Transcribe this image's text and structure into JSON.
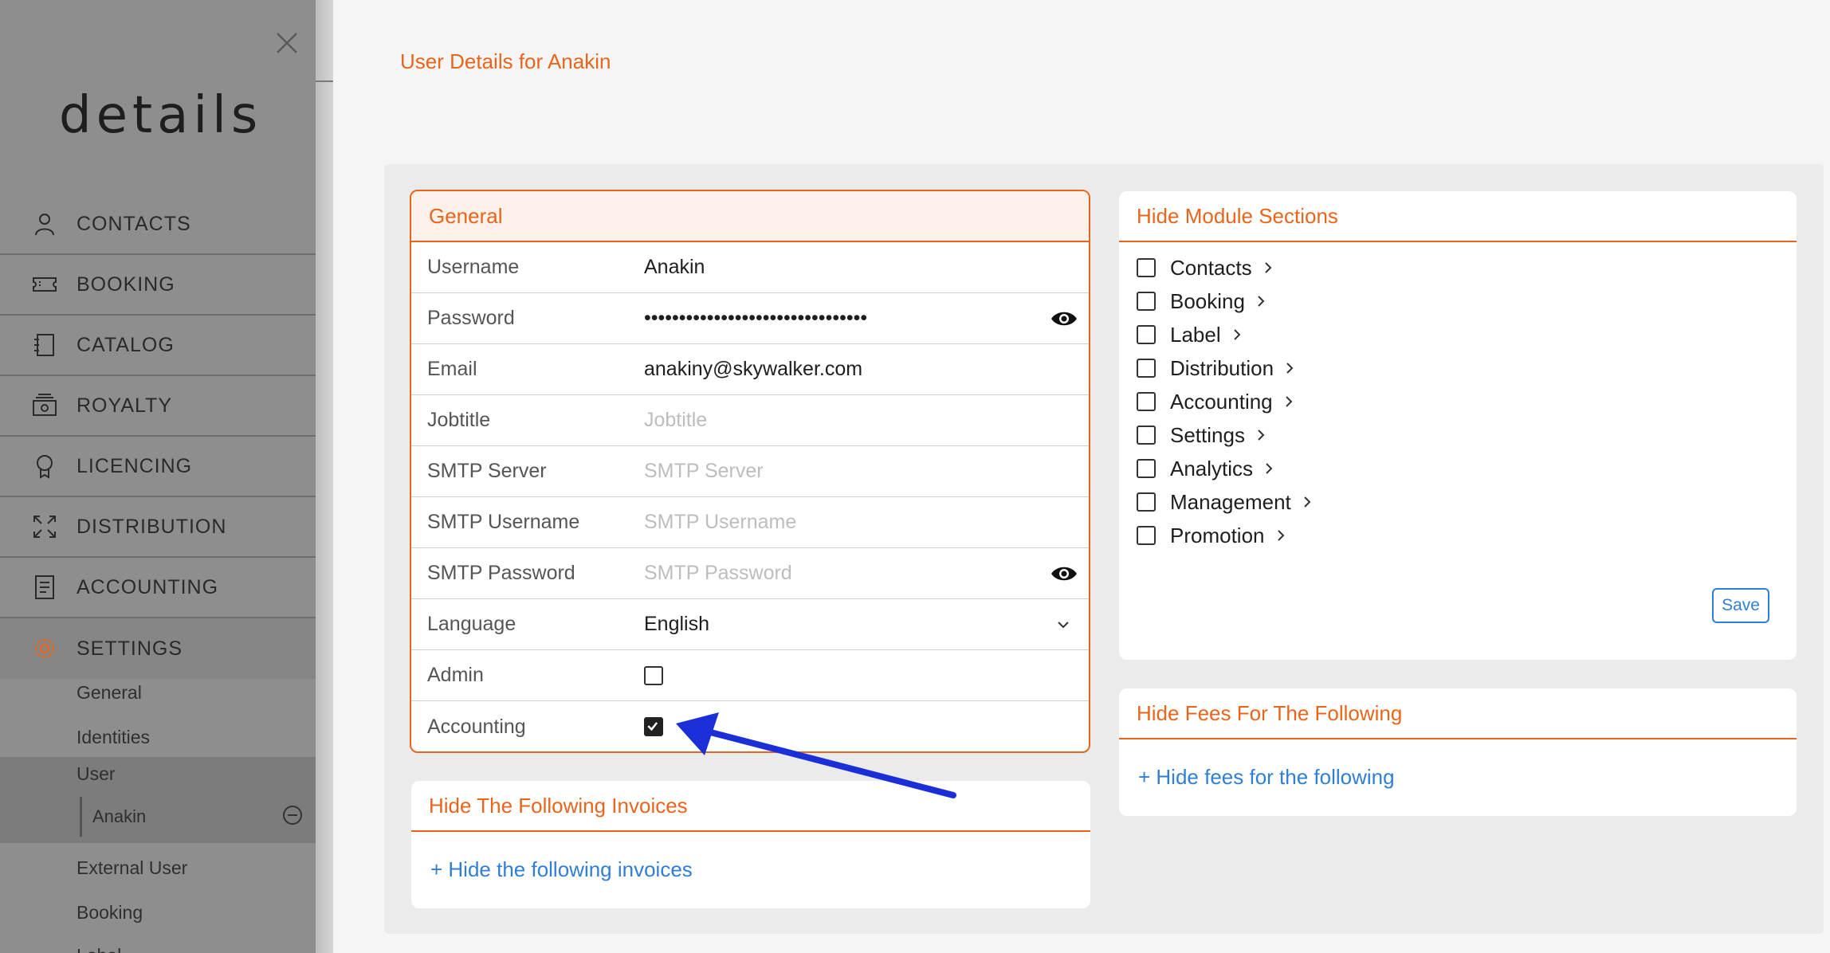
{
  "sidebar": {
    "logo": "details",
    "nav": [
      {
        "label": "CONTACTS",
        "icon": "person-icon"
      },
      {
        "label": "BOOKING",
        "icon": "ticket-icon"
      },
      {
        "label": "CATALOG",
        "icon": "catalog-icon"
      },
      {
        "label": "ROYALTY",
        "icon": "money-icon"
      },
      {
        "label": "LICENCING",
        "icon": "award-icon"
      },
      {
        "label": "DISTRIBUTION",
        "icon": "expand-icon"
      },
      {
        "label": "ACCOUNTING",
        "icon": "document-icon"
      },
      {
        "label": "SETTINGS",
        "icon": "gear-icon"
      }
    ],
    "settings_sub": {
      "general": "General",
      "identities": "Identities",
      "user": "User",
      "anakin": "Anakin",
      "external_user": "External User",
      "booking": "Booking",
      "label": "Label"
    },
    "accent_color": "#e8651c"
  },
  "page": {
    "title": "User Details for Anakin"
  },
  "general": {
    "title": "General",
    "fields": {
      "username": {
        "label": "Username",
        "value": "Anakin"
      },
      "password": {
        "label": "Password",
        "value": "••••••••••••••••••••••••••••••••"
      },
      "email": {
        "label": "Email",
        "value": "anakiny@skywalker.com"
      },
      "jobtitle": {
        "label": "Jobtitle",
        "placeholder": "Jobtitle"
      },
      "smtp_server": {
        "label": "SMTP Server",
        "placeholder": "SMTP Server"
      },
      "smtp_username": {
        "label": "SMTP Username",
        "placeholder": "SMTP Username"
      },
      "smtp_password": {
        "label": "SMTP Password",
        "placeholder": "SMTP Password"
      },
      "language": {
        "label": "Language",
        "value": "English"
      },
      "admin": {
        "label": "Admin",
        "checked": false
      },
      "accounting": {
        "label": "Accounting",
        "checked": true
      }
    }
  },
  "invoices": {
    "title": "Hide The Following Invoices",
    "add_link": "+ Hide the following invoices"
  },
  "modules": {
    "title": "Hide Module Sections",
    "items": [
      "Contacts",
      "Booking",
      "Label",
      "Distribution",
      "Accounting",
      "Settings",
      "Analytics",
      "Management",
      "Promotion"
    ],
    "save_label": "Save"
  },
  "fees": {
    "title": "Hide Fees For The Following",
    "add_link": "+ Hide fees for the following"
  },
  "colors": {
    "brand": "#e8651c",
    "link": "#2f7fd6",
    "arrow": "#1b2fd8"
  }
}
